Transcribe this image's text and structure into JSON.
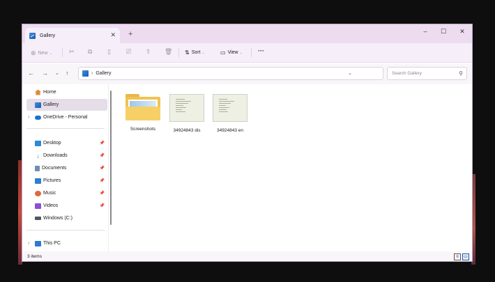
{
  "tab": {
    "title": "Gallery",
    "close": "✕",
    "new": "+"
  },
  "window_controls": {
    "minimize": "–",
    "maximize": "☐",
    "close": "✕"
  },
  "toolbar": {
    "new_label": "New",
    "sort_label": "Sort",
    "view_label": "View",
    "more_label": "···"
  },
  "address": {
    "path": "Gallery",
    "search_placeholder": "Search Gallery"
  },
  "nav": {
    "quick": [
      {
        "label": "Home",
        "icon": "home-icon"
      },
      {
        "label": "Gallery",
        "icon": "gallery-icon"
      },
      {
        "label": "OneDrive - Personal",
        "icon": "cloud-icon"
      }
    ],
    "pinned": [
      {
        "label": "Desktop",
        "icon": "desktop-icon"
      },
      {
        "label": "Downloads",
        "icon": "download-icon"
      },
      {
        "label": "Documents",
        "icon": "documents-icon"
      },
      {
        "label": "Pictures",
        "icon": "pictures-icon"
      },
      {
        "label": "Music",
        "icon": "music-icon"
      },
      {
        "label": "Videos",
        "icon": "videos-icon"
      },
      {
        "label": "Windows (C:)",
        "icon": "drive-icon"
      }
    ],
    "this_pc": "This PC"
  },
  "files": [
    {
      "name": "Screenshots",
      "kind": "folder"
    },
    {
      "name": "34924843 dis",
      "kind": "image"
    },
    {
      "name": "34924843 en",
      "kind": "image"
    }
  ],
  "status": {
    "count": "3 items"
  },
  "colors": {
    "accent": "#1a5bb0",
    "titlebar": "#eddcf0",
    "selection": "#e5dde7"
  }
}
